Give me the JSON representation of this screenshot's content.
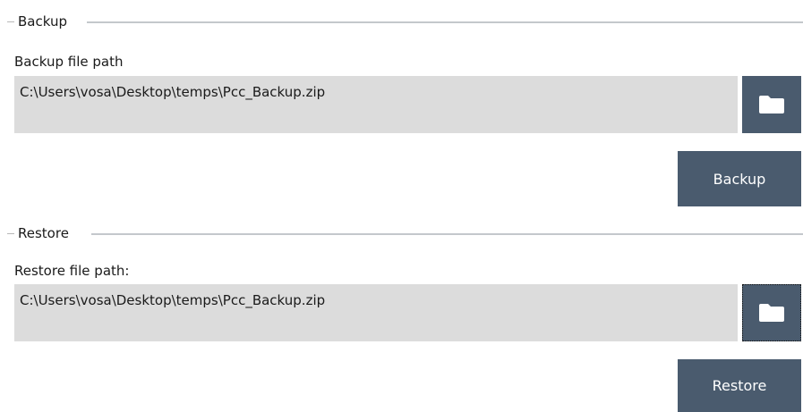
{
  "backup": {
    "group_title": "Backup",
    "path_label": "Backup file path",
    "path_value": "C:\\Users\\vosa\\Desktop\\temps\\Pcc_Backup.zip",
    "browse_icon": "folder-icon",
    "action_label": "Backup"
  },
  "restore": {
    "group_title": "Restore",
    "path_label": "Restore file path:",
    "path_value": "C:\\Users\\vosa\\Desktop\\temps\\Pcc_Backup.zip",
    "browse_icon": "folder-icon",
    "action_label": "Restore"
  },
  "colors": {
    "button_bg": "#4a5b6e",
    "field_bg": "#dcdcdc",
    "separator": "#c4c8cc"
  }
}
